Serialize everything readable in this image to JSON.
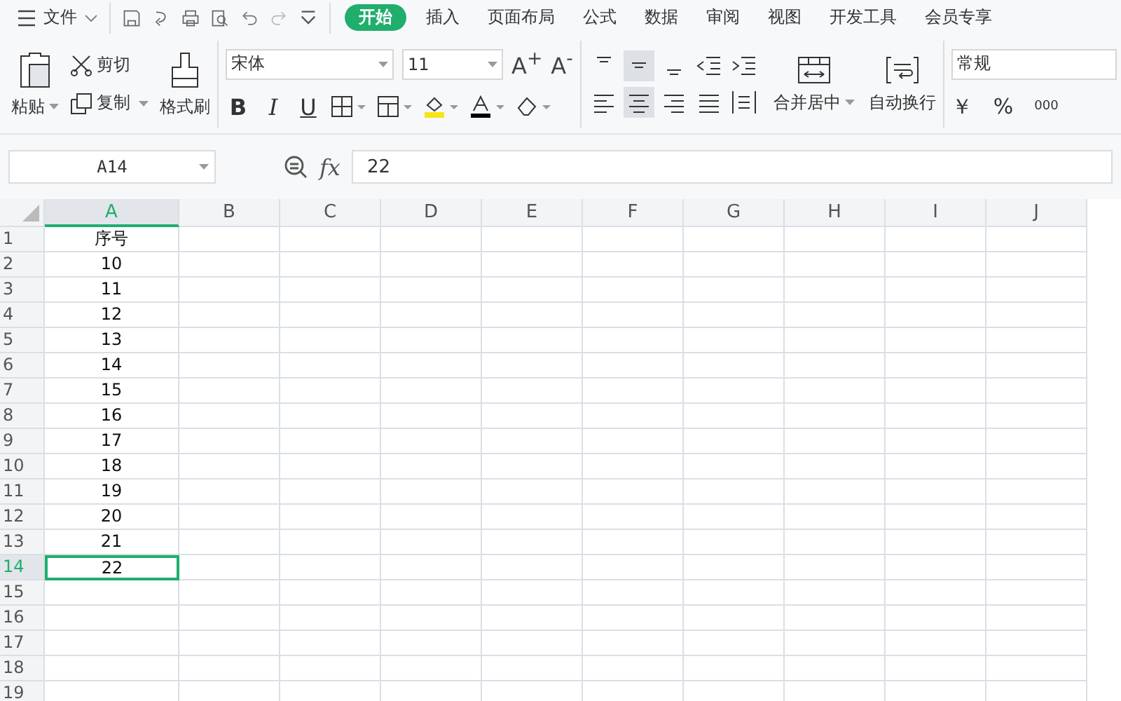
{
  "menu": {
    "file_label": "文件",
    "tabs": [
      {
        "label": "开始",
        "selected": true
      },
      {
        "label": "插入",
        "selected": false
      },
      {
        "label": "页面布局",
        "selected": false
      },
      {
        "label": "公式",
        "selected": false
      },
      {
        "label": "数据",
        "selected": false
      },
      {
        "label": "审阅",
        "selected": false
      },
      {
        "label": "视图",
        "selected": false
      },
      {
        "label": "开发工具",
        "selected": false
      },
      {
        "label": "会员专享",
        "selected": false
      }
    ]
  },
  "ribbon": {
    "paste": "粘贴",
    "cut": "剪切",
    "copy": "复制",
    "format_painter": "格式刷",
    "font_name": "宋体",
    "font_size": "11",
    "font_size_buttons": [
      "A$^{+}$",
      "A$^{-}$"
    ],
    "style_buttons": [
      "B",
      "I",
      "U"
    ],
    "merge": "合并居中",
    "wrap": "自动换行",
    "number_format": "常规",
    "number_buttons": [
      "￥",
      "%",
      "000"
    ],
    "align_top": [
      {
        "selected": false
      },
      {
        "selected": true
      },
      {
        "selected": false
      }
    ],
    "align_bottom": [
      {
        "selected": false
      },
      {
        "selected": true
      },
      {
        "selected": false
      },
      {
        "selected": false
      }
    ]
  },
  "formula_bar": {
    "cell_ref": "A14",
    "fx": "fx",
    "value": "22"
  },
  "sheet": {
    "columns": [
      {
        "label": "A",
        "selected": true
      },
      {
        "label": "B",
        "selected": false
      },
      {
        "label": "C",
        "selected": false
      },
      {
        "label": "D",
        "selected": false
      },
      {
        "label": "E",
        "selected": false
      },
      {
        "label": "F",
        "selected": false
      },
      {
        "label": "G",
        "selected": false
      },
      {
        "label": "H",
        "selected": false
      },
      {
        "label": "I",
        "selected": false
      },
      {
        "label": "J",
        "selected": false
      }
    ],
    "rows": [
      {
        "header": "1",
        "a": "序号",
        "selected": false
      },
      {
        "header": "2",
        "a": "10",
        "selected": false
      },
      {
        "header": "3",
        "a": "11",
        "selected": false
      },
      {
        "header": "4",
        "a": "12",
        "selected": false
      },
      {
        "header": "5",
        "a": "13",
        "selected": false
      },
      {
        "header": "6",
        "a": "14",
        "selected": false
      },
      {
        "header": "7",
        "a": "15",
        "selected": false
      },
      {
        "header": "8",
        "a": "16",
        "selected": false
      },
      {
        "header": "9",
        "a": "17",
        "selected": false
      },
      {
        "header": "10",
        "a": "18",
        "selected": false
      },
      {
        "header": "11",
        "a": "19",
        "selected": false
      },
      {
        "header": "12",
        "a": "20",
        "selected": false
      },
      {
        "header": "13",
        "a": "21",
        "selected": false
      },
      {
        "header": "14",
        "a": "22",
        "selected": true
      },
      {
        "header": "15",
        "selected": false
      },
      {
        "header": "16",
        "selected": false
      },
      {
        "header": "17",
        "selected": false
      },
      {
        "header": "18",
        "selected": false
      },
      {
        "header": "19",
        "selected": false
      }
    ]
  }
}
